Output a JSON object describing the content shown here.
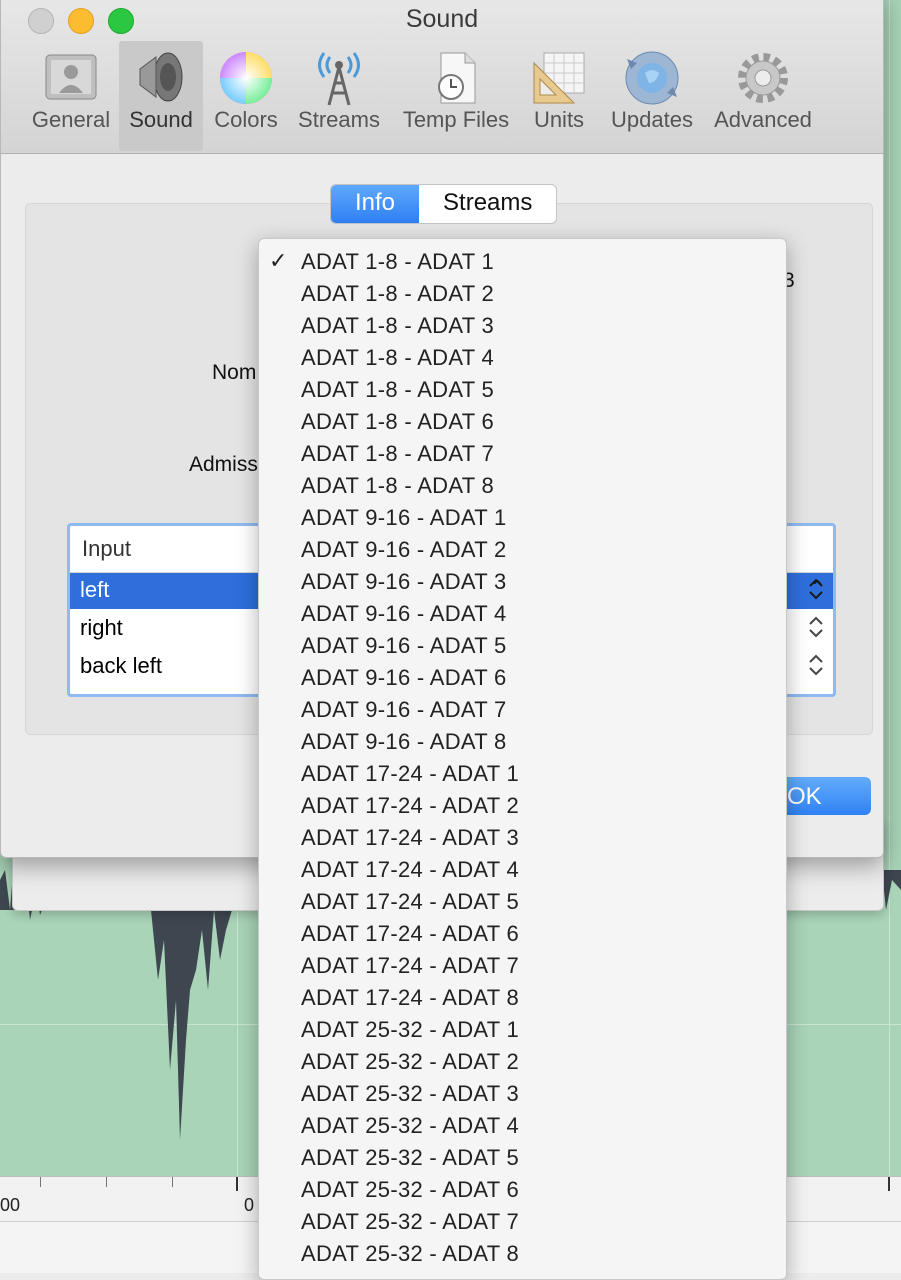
{
  "window": {
    "title": "Sound",
    "toolbar": [
      {
        "label": "General",
        "icon": "general-icon"
      },
      {
        "label": "Sound",
        "icon": "speaker-icon",
        "selected": true
      },
      {
        "label": "Colors",
        "icon": "color-wheel-icon"
      },
      {
        "label": "Streams",
        "icon": "antenna-icon"
      },
      {
        "label": "Temp Files",
        "icon": "clock-document-icon"
      },
      {
        "label": "Units",
        "icon": "ruler-triangle-icon"
      },
      {
        "label": "Updates",
        "icon": "refresh-globe-icon"
      },
      {
        "label": "Advanced",
        "icon": "gear-icon"
      }
    ]
  },
  "tabs": {
    "info": "Info",
    "streams": "Streams"
  },
  "labels": {
    "nominal_partial": "Nom",
    "admiss_partial": "Admiss",
    "right_edge_fragment": "3"
  },
  "channel_table": {
    "header": "Input",
    "rows": [
      {
        "label": "left",
        "selected": true
      },
      {
        "label": "right",
        "selected": false
      },
      {
        "label": "back left",
        "selected": false
      }
    ]
  },
  "ok_button": "OK",
  "ruler": {
    "left_label": "00",
    "mid_label": "0"
  },
  "menu": {
    "checked_index": 0,
    "items": [
      "ADAT 1-8 - ADAT 1",
      "ADAT 1-8 - ADAT 2",
      "ADAT 1-8 - ADAT 3",
      "ADAT 1-8 - ADAT 4",
      "ADAT 1-8 - ADAT 5",
      "ADAT 1-8 - ADAT 6",
      "ADAT 1-8 - ADAT 7",
      "ADAT 1-8 - ADAT 8",
      "ADAT 9-16 - ADAT 1",
      "ADAT 9-16 - ADAT 2",
      "ADAT 9-16 - ADAT 3",
      "ADAT 9-16 - ADAT 4",
      "ADAT 9-16 - ADAT 5",
      "ADAT 9-16 - ADAT 6",
      "ADAT 9-16 - ADAT 7",
      "ADAT 9-16 - ADAT 8",
      "ADAT 17-24 - ADAT 1",
      "ADAT 17-24 - ADAT 2",
      "ADAT 17-24 - ADAT 3",
      "ADAT 17-24 - ADAT 4",
      "ADAT 17-24 - ADAT 5",
      "ADAT 17-24 - ADAT 6",
      "ADAT 17-24 - ADAT 7",
      "ADAT 17-24 - ADAT 8",
      "ADAT 25-32 - ADAT 1",
      "ADAT 25-32 - ADAT 2",
      "ADAT 25-32 - ADAT 3",
      "ADAT 25-32 - ADAT 4",
      "ADAT 25-32 - ADAT 5",
      "ADAT 25-32 - ADAT 6",
      "ADAT 25-32 - ADAT 7",
      "ADAT 25-32 - ADAT 8"
    ]
  },
  "colors": {
    "accent": "#2f7ff4",
    "selection": "#2e6fdc",
    "waveform_bg": "#a9d4b8",
    "waveform": "#3e4650"
  }
}
